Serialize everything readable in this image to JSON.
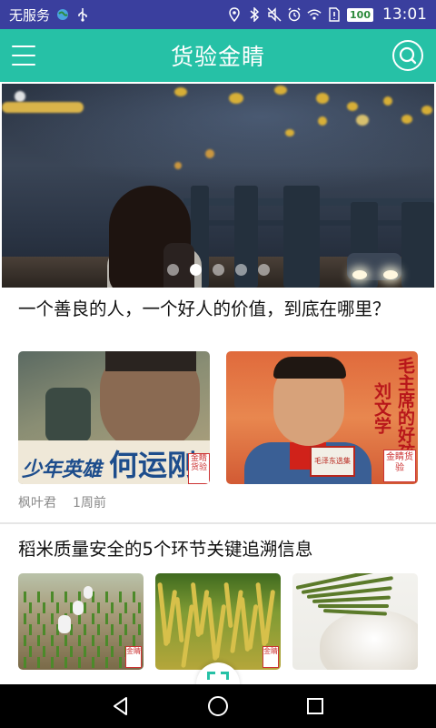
{
  "status_bar": {
    "carrier": "无服务",
    "battery": "100",
    "time": "13:01",
    "icons": [
      "globe-icon",
      "usb-icon",
      "location-icon",
      "bluetooth-icon",
      "mute-icon",
      "alarm-icon",
      "wifi-icon",
      "sim-alert-icon",
      "battery-icon"
    ]
  },
  "header": {
    "title": "货验金睛",
    "left_icon": "menu-icon",
    "right_icon": "search-icon"
  },
  "banner": {
    "slide_count": 5,
    "active_index": 1
  },
  "articles": [
    {
      "title": "一个善良的人，一个好人的价值，到底在哪里？",
      "poster_left": {
        "caption_small": "少年英雄",
        "caption_large": "何运刚",
        "seal": "金睛货验"
      },
      "poster_right": {
        "vertical_text_1": "毛主席的好孩子",
        "vertical_text_2": "刘文学",
        "book_text": "毛泽东选集",
        "seal": "金睛货验"
      },
      "author": "枫叶君",
      "time": "1周前"
    },
    {
      "title": "稻米质量安全的5个环节关键追溯信息",
      "thumb_seal": "金睛"
    }
  ],
  "colors": {
    "status_bar": "#3a3f9e",
    "app_bar": "#26c1a6",
    "accent": "#26c1a6",
    "meta_text": "#8a8a8a"
  },
  "nav": {
    "back": "back-icon",
    "home": "home-icon",
    "recents": "recents-icon",
    "scan": "scan-icon"
  }
}
